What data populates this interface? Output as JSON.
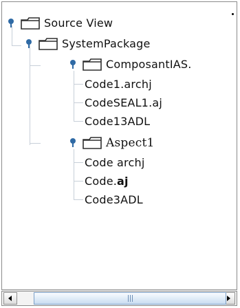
{
  "tree": {
    "root": {
      "label": "Source View",
      "expanded": true,
      "icon": "folder-icon",
      "children": [
        {
          "label": "SystemPackage",
          "expanded": true,
          "icon": "folder-icon",
          "children": [
            {
              "label": "ComposantIAS.",
              "expanded": true,
              "icon": "folder-icon",
              "children": [
                {
                  "label": "Code1.archj",
                  "icon": "file-leaf"
                },
                {
                  "label": "CodeSEAL1.aj",
                  "icon": "file-leaf"
                },
                {
                  "label": "Code13ADL",
                  "icon": "file-leaf"
                }
              ]
            },
            {
              "label": "Aspect1",
              "expanded": true,
              "icon": "folder-icon",
              "children": [
                {
                  "label": "Code archj",
                  "icon": "file-leaf"
                },
                {
                  "label_plain": "Code.",
                  "label_bold": "aj",
                  "icon": "file-leaf"
                },
                {
                  "label": "Code3ADL",
                  "icon": "file-leaf"
                }
              ]
            }
          ]
        }
      ]
    }
  },
  "scrollbar": {
    "left_icon": "left-arrow-icon",
    "right_icon": "right-arrow-icon",
    "thumb_grip_icon": "grip-icon",
    "position_fraction": 0.08,
    "visible_fraction": 0.9
  },
  "colors": {
    "guide": "#c7cfd8",
    "handle": "#2f6aa5",
    "folder_border": "#2e2e2e",
    "folder_fill": "#ffffff"
  }
}
